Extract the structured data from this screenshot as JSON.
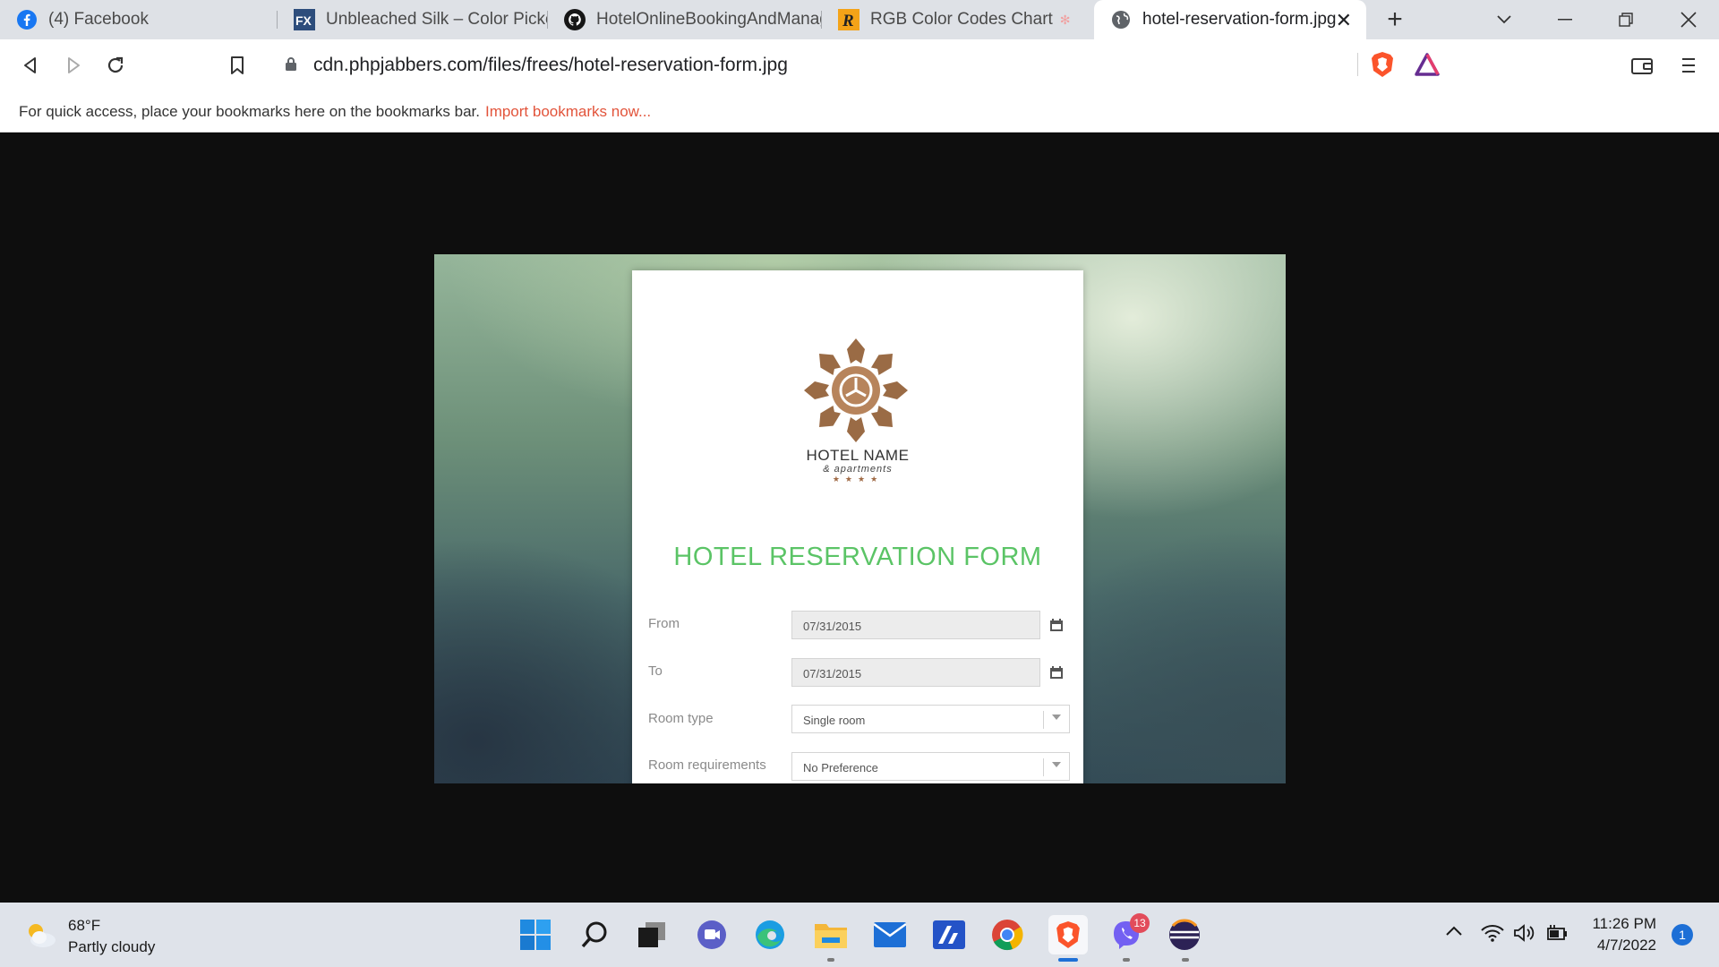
{
  "browser": {
    "tabs": [
      {
        "title": "(4) Facebook",
        "icon": "facebook-icon"
      },
      {
        "title": "Unbleached Silk – Color Picker | FX",
        "icon": "fx-icon"
      },
      {
        "title": "HotelOnlineBookingAndManagement",
        "icon": "github-icon"
      },
      {
        "title": "RGB Color Codes Chart",
        "icon": "r-icon"
      },
      {
        "title": "hotel-reservation-form.jpg",
        "icon": "globe-icon"
      }
    ],
    "url": "cdn.phpjabbers.com/files/frees/hotel-reservation-form.jpg",
    "bookmarks_bar": {
      "message": "For quick access, place your bookmarks here on the bookmarks bar.",
      "link": "Import bookmarks now..."
    }
  },
  "image": {
    "hotel_name": "HOTEL NAME",
    "hotel_subtitle": "& apartments",
    "stars": "★★★★",
    "form_title": "HOTEL RESERVATION FORM",
    "fields": [
      {
        "label": "From",
        "value": "07/31/2015"
      },
      {
        "label": "To",
        "value": "07/31/2015"
      },
      {
        "label": "Room type",
        "value": "Single room"
      },
      {
        "label": "Room requirements",
        "value": "No Preference"
      }
    ],
    "accent_color": "#5bc466",
    "logo_color": "#9a6b45"
  },
  "taskbar": {
    "weather": {
      "temp": "68°F",
      "condition": "Partly cloudy"
    },
    "viber_badge": "13",
    "clock": {
      "time": "11:26 PM",
      "date": "4/7/2022"
    },
    "notifications": "1"
  }
}
